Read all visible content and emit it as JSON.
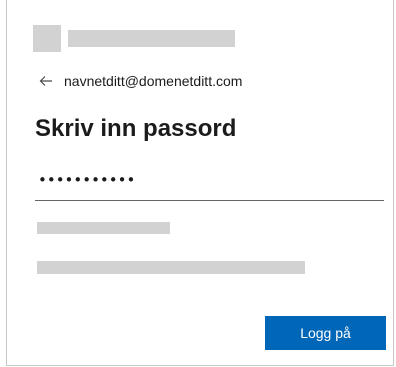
{
  "header": {
    "identity_email": "navnetditt@domenetditt.com",
    "back_icon": "arrow-left-icon"
  },
  "main": {
    "title": "Skriv inn passord",
    "password_value": "•••••••••••"
  },
  "actions": {
    "signin_label": "Logg på"
  },
  "colors": {
    "accent": "#0067b8",
    "text": "#1b1b1b",
    "placeholder_block": "#d2d2d2",
    "border": "#c8c8c8"
  }
}
